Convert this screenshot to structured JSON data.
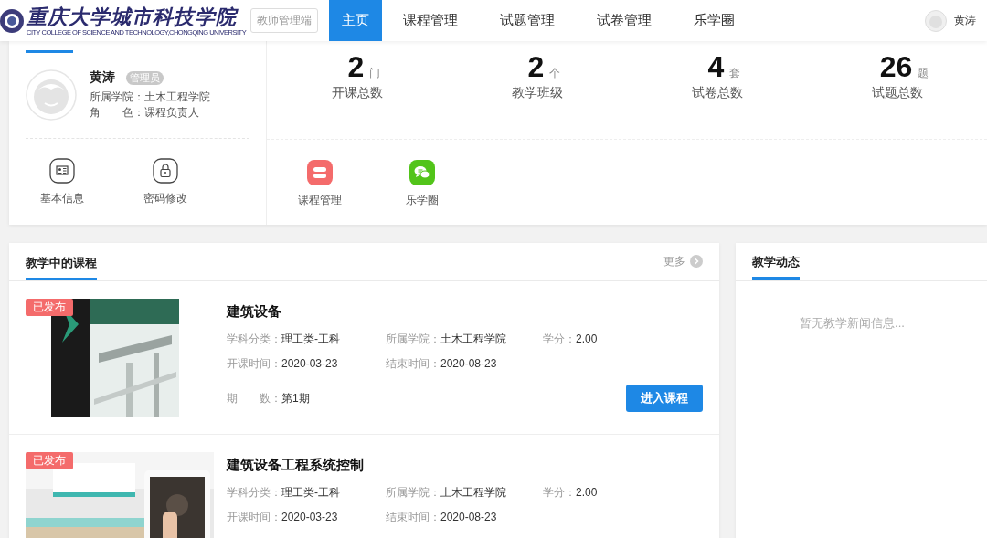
{
  "header": {
    "logo_title": "重庆大学城市科技学院",
    "logo_subtitle": "CITY COLLEGE OF SCIENCE AND TECHNOLOGY,CHONGQING UNIVERSITY",
    "portal_badge": "教师管理端",
    "nav": [
      {
        "label": "主页",
        "selected": true
      },
      {
        "label": "课程管理",
        "selected": false
      },
      {
        "label": "试题管理",
        "selected": false
      },
      {
        "label": "试卷管理",
        "selected": false
      },
      {
        "label": "乐学圈",
        "selected": false
      }
    ],
    "user_name": "黄涛"
  },
  "profile": {
    "name": "黄涛",
    "role_badge": "管理员",
    "fields": [
      {
        "label": "所属学院：",
        "value": "土木工程学院"
      },
      {
        "label": "角　　色：",
        "value": "课程负责人"
      }
    ],
    "actions": [
      {
        "kind": "id-card",
        "label": "基本信息"
      },
      {
        "kind": "lock",
        "label": "密码修改"
      }
    ]
  },
  "stats": [
    {
      "value": "2",
      "unit": "门",
      "label": "开课总数"
    },
    {
      "value": "2",
      "unit": "个",
      "label": "教学班级"
    },
    {
      "value": "4",
      "unit": "套",
      "label": "试卷总数"
    },
    {
      "value": "26",
      "unit": "题",
      "label": "试题总数"
    }
  ],
  "quick_links": [
    {
      "kind": "course",
      "label": "课程管理",
      "color": "#f46b6b"
    },
    {
      "kind": "chat",
      "label": "乐学圈",
      "color": "#52c41a"
    }
  ],
  "courses": {
    "title": "教学中的课程",
    "more": "更多",
    "items": [
      {
        "kind": "book",
        "status": "已发布",
        "title": "建筑设备",
        "rows": [
          [
            {
              "label": "学科分类：",
              "value": "理工类-工科"
            },
            {
              "label": "所属学院：",
              "value": "土木工程学院"
            },
            {
              "label": "学分：",
              "value": "2.00"
            }
          ],
          [
            {
              "label": "开课时间：",
              "value": "2020-03-23"
            },
            {
              "label": "结束时间：",
              "value": "2020-08-23"
            }
          ]
        ],
        "term": {
          "label": "期　　数：",
          "value": "第1期"
        },
        "action": "进入课程"
      },
      {
        "kind": "kitchen",
        "status": "已发布",
        "title": "建筑设备工程系统控制",
        "rows": [
          [
            {
              "label": "学科分类：",
              "value": "理工类-工科"
            },
            {
              "label": "所属学院：",
              "value": "土木工程学院"
            },
            {
              "label": "学分：",
              "value": "2.00"
            }
          ],
          [
            {
              "label": "开课时间：",
              "value": "2020-03-23"
            },
            {
              "label": "结束时间：",
              "value": "2020-08-23"
            }
          ]
        ]
      }
    ]
  },
  "news": {
    "title": "教学动态",
    "empty_text": "暂无教学新闻信息..."
  }
}
